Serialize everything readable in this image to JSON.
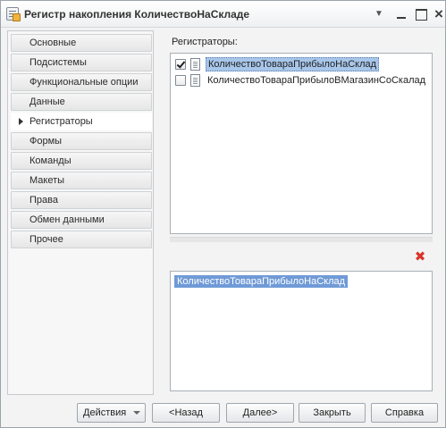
{
  "window": {
    "title": "Регистр накопления КоличествоНаСкладе",
    "controls": {
      "menu_glyph": "▼",
      "close_glyph": "×"
    }
  },
  "sidebar": {
    "items": [
      {
        "label": "Основные",
        "active": false
      },
      {
        "label": "Подсистемы",
        "active": false
      },
      {
        "label": "Функциональные опции",
        "active": false
      },
      {
        "label": "Данные",
        "active": false
      },
      {
        "label": "Регистраторы",
        "active": true
      },
      {
        "label": "Формы",
        "active": false
      },
      {
        "label": "Команды",
        "active": false
      },
      {
        "label": "Макеты",
        "active": false
      },
      {
        "label": "Права",
        "active": false
      },
      {
        "label": "Обмен данными",
        "active": false
      },
      {
        "label": "Прочее",
        "active": false
      }
    ]
  },
  "registrators": {
    "label": "Регистраторы:",
    "items": [
      {
        "name": "КоличествоТовараПрибылоНаСклад",
        "checked": true
      },
      {
        "name": "КоличествоТовараПрибылоВМагазинСоСкалад",
        "checked": false
      }
    ]
  },
  "details": {
    "selected_value": "КоличествоТовараПрибылоНаСклад"
  },
  "icons": {
    "delete": "delete-icon",
    "document": "document-icon"
  },
  "colors": {
    "selection": "#6f9ad6",
    "delete": "#d9342b"
  },
  "buttons": {
    "actions": "Действия",
    "back": "<Назад",
    "next": "Далее>",
    "close": "Закрыть",
    "help": "Справка"
  }
}
